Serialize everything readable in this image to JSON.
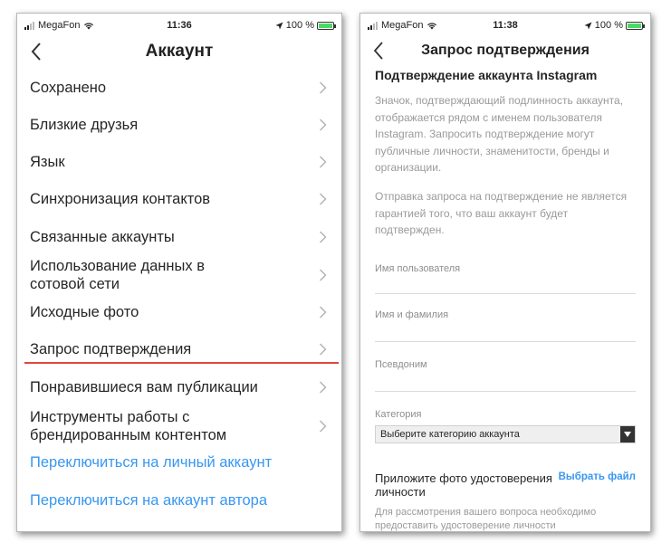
{
  "left_phone": {
    "status_bar": {
      "carrier": "MegaFon",
      "time": "11:36",
      "battery": "100 %",
      "battery_level": 1.0
    },
    "nav": {
      "title": "Аккаунт"
    },
    "menu": [
      {
        "label": "Сохранено"
      },
      {
        "label": "Близкие друзья"
      },
      {
        "label": "Язык"
      },
      {
        "label": "Синхронизация контактов"
      },
      {
        "label": "Связанные аккаунты"
      },
      {
        "label": "Использование данных в\nсотовой сети"
      },
      {
        "label": "Исходные фото"
      },
      {
        "label": "Запрос подтверждения"
      },
      {
        "label": "Понравившиеся вам публикации"
      },
      {
        "label": "Инструменты работы с\nбрендированным контентом"
      }
    ],
    "links": [
      {
        "label": "Переключиться на личный аккаунт"
      },
      {
        "label": "Переключиться на аккаунт автора"
      }
    ],
    "colors": {
      "link": "#3897f0",
      "highlight_underline": "#e0463a"
    }
  },
  "right_phone": {
    "status_bar": {
      "carrier": "MegaFon",
      "time": "11:38",
      "battery": "100 %",
      "battery_level": 1.0
    },
    "nav": {
      "title": "Запрос подтверждения"
    },
    "heading": "Подтверждение аккаунта Instagram",
    "paragraph1": "Значок, подтверждающий подлинность аккаунта, отображается рядом с именем пользователя Instagram. Запросить подтверждение могут публичные личности, знаменитости, бренды и организации.",
    "paragraph2": "Отправка запроса на подтверждение не является гарантией того, что ваш аккаунт будет подтвержден.",
    "fields": {
      "username": {
        "label": "Имя пользователя",
        "value": ""
      },
      "fullname": {
        "label": "Имя и фамилия",
        "value": ""
      },
      "alias": {
        "label": "Псевдоним",
        "value": ""
      },
      "category": {
        "label": "Категория",
        "selected": "Выберите категорию аккаунта"
      }
    },
    "upload": {
      "label": "Приложите фото удостоверения личности",
      "action": "Выбрать файл"
    },
    "note": "Для рассмотрения вашего вопроса необходимо предоставить удостоверение личности"
  }
}
